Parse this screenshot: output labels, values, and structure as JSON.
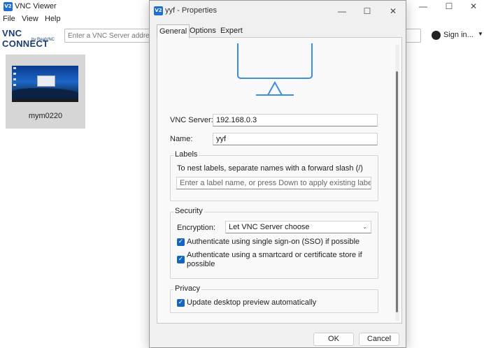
{
  "main_window": {
    "title": "VNC Viewer",
    "app_icon": "V2",
    "menu": [
      "File",
      "View",
      "Help"
    ],
    "logo": {
      "line1": "vnc connect",
      "line2": "by RealVNC"
    },
    "address_placeholder": "Enter a VNC Server address or search",
    "sign_in_label": "Sign in...",
    "connections": [
      {
        "name": "mym0220"
      }
    ],
    "controls": {
      "minimize": "—",
      "maximize": "☐",
      "close": "✕"
    }
  },
  "dialog": {
    "title": "yyf - Properties",
    "tabs": [
      "General",
      "Options",
      "Expert"
    ],
    "active_tab": "General",
    "vnc_server": {
      "label": "VNC Server:",
      "value": "192.168.0.3"
    },
    "name": {
      "label": "Name:",
      "value": "yyf"
    },
    "labels_group": {
      "title": "Labels",
      "hint": "To nest labels, separate names with a forward slash (/)",
      "placeholder": "Enter a label name, or press Down to apply existing labels"
    },
    "security_group": {
      "title": "Security",
      "encryption_label": "Encryption:",
      "encryption_value": "Let VNC Server choose",
      "sso_label": "Authenticate using single sign-on (SSO) if possible",
      "sso_checked": true,
      "smartcard_label_line1": "Authenticate using a smartcard or certificate store if",
      "smartcard_label_line2": "possible",
      "smartcard_checked": true
    },
    "privacy_group": {
      "title": "Privacy",
      "preview_label": "Update desktop preview automatically",
      "preview_checked": true
    },
    "ok_label": "OK",
    "cancel_label": "Cancel",
    "check_glyph": "✓"
  },
  "colors": {
    "accent": "#1565c0",
    "monitor_stroke": "#3b8de0",
    "app_icon": "#1f6fd1"
  }
}
